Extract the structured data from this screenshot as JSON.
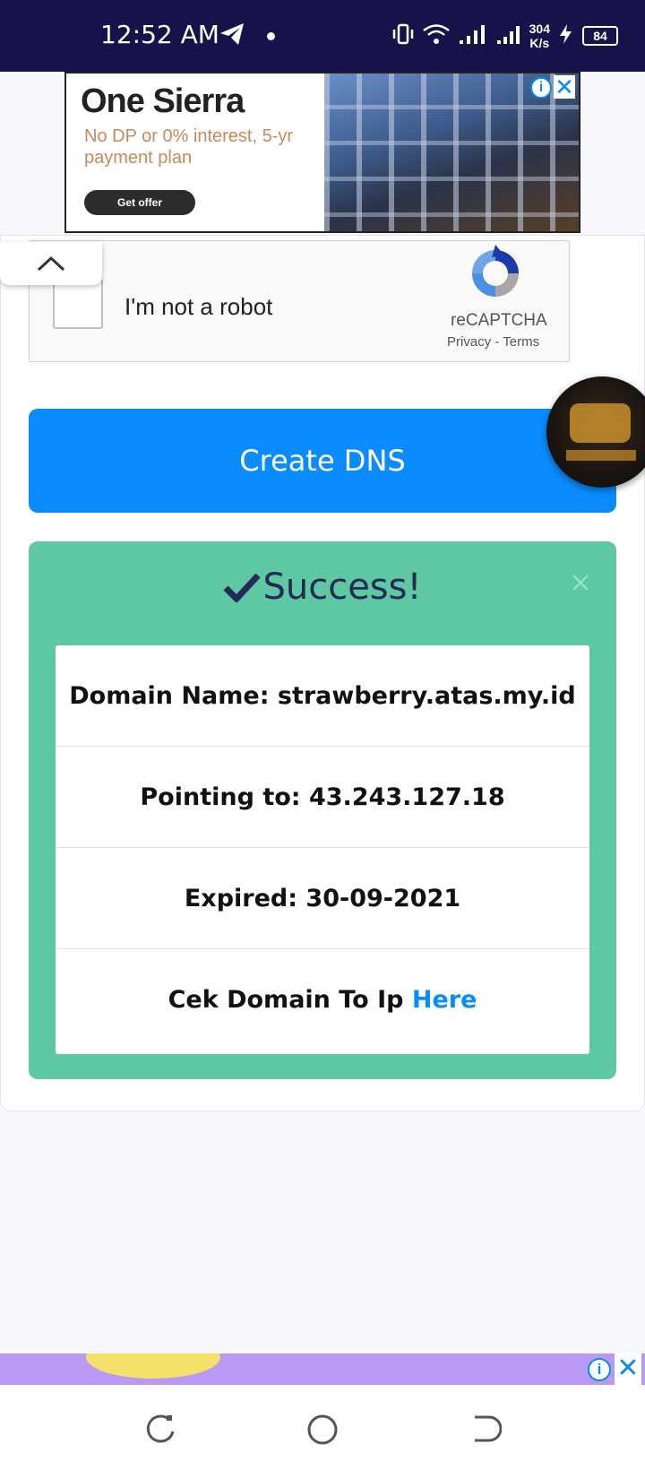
{
  "status_bar": {
    "time": "12:52 AM",
    "net_speed_value": "304",
    "net_speed_unit": "K/s",
    "battery": "84"
  },
  "ad_top": {
    "brand": "One Sierra",
    "copy": "No DP or 0% interest, 5-yr payment plan",
    "cta": "Get offer"
  },
  "recaptcha": {
    "label": "I'm not a robot",
    "brand": "reCAPTCHA",
    "privacy": "Privacy",
    "separator": " - ",
    "terms": "Terms"
  },
  "create_button": "Create DNS",
  "result": {
    "title": "Success!",
    "domain": "Domain Name: strawberry.atas.my.id",
    "pointing": "Pointing to: 43.243.127.18",
    "expired": "Expired: 30-09-2021",
    "check_prefix": "Cek Domain To Ip ",
    "check_link": "Here"
  },
  "colors": {
    "status_bar": "#15134a",
    "primary": "#0a8cff",
    "success": "#5ec8a3",
    "success_title": "#242a55"
  }
}
